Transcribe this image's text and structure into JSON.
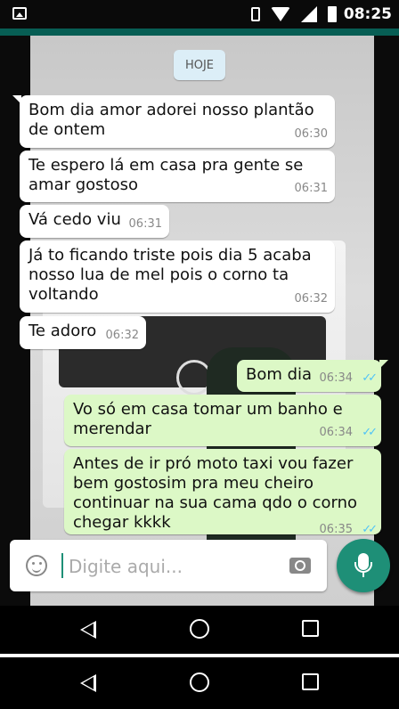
{
  "status_bar": {
    "time": "08:25",
    "icons": [
      "gallery-icon",
      "vibrate-icon",
      "wifi-icon",
      "signal-icon",
      "battery-icon"
    ]
  },
  "chat": {
    "date_label": "HOJE",
    "messages": [
      {
        "dir": "in",
        "text": "Bom dia amor adorei nosso plantão de ontem",
        "time": "06:30"
      },
      {
        "dir": "in",
        "text": "Te espero lá em casa pra gente se amar gostoso",
        "time": "06:31"
      },
      {
        "dir": "in",
        "text": "Vá cedo viu",
        "time": "06:31"
      },
      {
        "dir": "in",
        "text": "Já to ficando triste pois dia 5 acaba nosso lua de mel pois o corno ta voltando",
        "time": "06:32"
      },
      {
        "dir": "in",
        "text": "Te adoro",
        "time": "06:32"
      },
      {
        "dir": "out",
        "text": "Bom dia",
        "time": "06:34",
        "ticks": "✓✓"
      },
      {
        "dir": "out",
        "text": "Vo só em casa tomar um banho e merendar",
        "time": "06:34",
        "ticks": "✓✓"
      },
      {
        "dir": "out",
        "text": "Antes de ir pró moto taxi vou fazer bem gostosim pra meu cheiro continuar na sua cama qdo o corno chegar kkkk",
        "time": "06:35",
        "ticks": "✓✓"
      }
    ]
  },
  "composer": {
    "placeholder": "Digite aqui...",
    "emoji_icon": "emoji-icon",
    "camera_icon": "camera-icon",
    "mic_icon": "mic-icon"
  },
  "colors": {
    "header_teal": "#075e54",
    "outgoing_bubble": "#dcf8c6",
    "incoming_bubble": "#ffffff",
    "read_ticks": "#4fc3f7",
    "mic_button": "#1e8f77"
  }
}
